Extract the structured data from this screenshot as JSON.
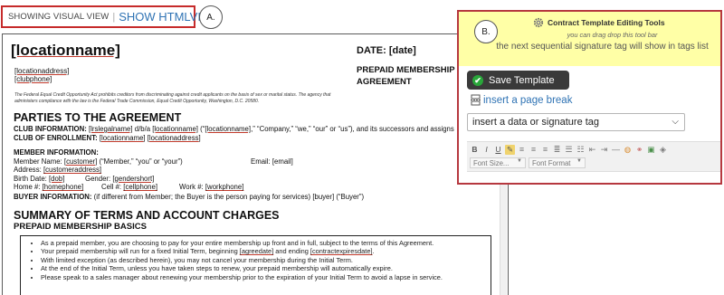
{
  "view_switch": {
    "visual_label": "SHOWING VISUAL VIEW",
    "separator": "|",
    "html_label": "SHOW HTMLVIEW",
    "callout": "A."
  },
  "document": {
    "location_name": "[locationname]",
    "date_label": "DATE: [date]",
    "location_address": "[locationaddress]",
    "club_phone": "[clubphone]",
    "prepaid_heading_1": "PREPAID MEMBERSHIP",
    "prepaid_heading_2": "AGREEMENT",
    "legal_text": "The Federal Equal Credit Opportunity Act prohibits creditors from discriminating against credit applicants on the basis of sex or marital status. The agency that administers compliance with the law is the Federal Trade Commission, Equal Credit Opportunity, Washington, D.C. 20580.",
    "parties_heading": "PARTIES TO THE AGREEMENT",
    "club_info": {
      "label": "CLUB INFORMATION:",
      "legal_name": "[lrslegalname]",
      "dba": "d/b/a",
      "location_name": "[locationname]",
      "paren_open": "(“",
      "location_name_2": "[locationname]",
      "rest": ",” “Company,” “we,” “our” or “us”), and its successors and assigns"
    },
    "club_enrollment": {
      "label": "CLUB OF ENROLLMENT:",
      "location_name": "[locationname]",
      "location_address": "[locationaddress]"
    },
    "member_info": {
      "label": "MEMBER INFORMATION:",
      "name_label": "Member Name:",
      "customer": "[customer]",
      "name_rest": "(“Member,” “you” or “your”)",
      "email_label": "Email:",
      "email": "[email]",
      "address_label": "Address:",
      "address": "[customeraddress]",
      "birth_label": "Birth Date:",
      "dob": "[dob]",
      "gender_label": "Gender:",
      "gender": "[gendershort]",
      "home_label": "Home #:",
      "home_phone": "[homephone]",
      "cell_label": "Cell #:",
      "cell_phone": "[cellphone]",
      "work_label": "Work #:",
      "work_phone": "[workphone]"
    },
    "buyer_info": {
      "label": "BUYER INFORMATION:",
      "text": "(if different from Member; the Buyer is the person paying for services) [buyer] (“Buyer”)"
    },
    "summary_heading": "SUMMARY OF TERMS AND ACCOUNT CHARGES",
    "basics_heading": "PREPAID MEMBERSHIP BASICS",
    "terms": {
      "item_1": "As a prepaid member, you are choosing to pay for your entire membership up front and in full, subject to the terms of this Agreement.",
      "item_2_a": "Your prepaid membership will run for a fixed Initial Term, beginning",
      "item_2_start": "[agreedate]",
      "item_2_b": "and ending",
      "item_2_end": "[contractexpiresdate]",
      "item_2_c": ".",
      "item_3": "With limited exception (as described herein), you may not cancel your membership during the Initial Term.",
      "item_4": "At the end of the Initial Term, unless you have taken steps to renew, your prepaid membership will automatically expire.",
      "item_5": "Please speak to a sales manager about renewing your membership prior to the expiration of your Initial Term to avoid a lapse in service."
    }
  },
  "tools_panel": {
    "callout": "B.",
    "title": "Contract Template Editing Tools",
    "subtitle": "you can drag drop this tool bar",
    "note": "the next sequential signature tag will show in tags list",
    "save_label": "Save Template",
    "page_break_label": "insert a page break",
    "data_tag_select": "insert a data or signature tag",
    "font_size_label": "Font Size...",
    "font_format_label": "Font Format",
    "toolbar": {
      "bold": "B",
      "italic": "I",
      "underline": "U",
      "strikethrough": "S"
    }
  }
}
